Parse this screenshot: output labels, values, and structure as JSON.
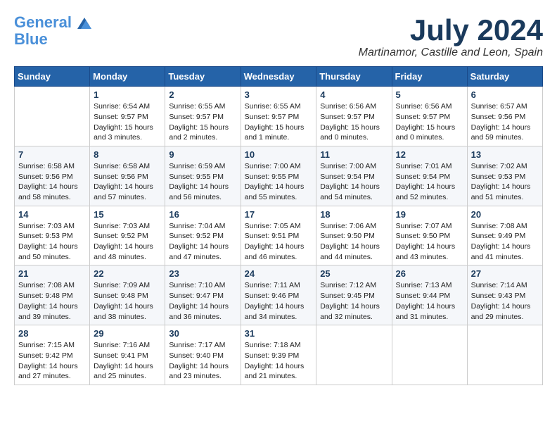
{
  "logo": {
    "line1": "General",
    "line2": "Blue"
  },
  "header": {
    "month": "July 2024",
    "location": "Martinamor, Castille and Leon, Spain"
  },
  "weekdays": [
    "Sunday",
    "Monday",
    "Tuesday",
    "Wednesday",
    "Thursday",
    "Friday",
    "Saturday"
  ],
  "weeks": [
    [
      {
        "day": "",
        "info": ""
      },
      {
        "day": "1",
        "info": "Sunrise: 6:54 AM\nSunset: 9:57 PM\nDaylight: 15 hours\nand 3 minutes."
      },
      {
        "day": "2",
        "info": "Sunrise: 6:55 AM\nSunset: 9:57 PM\nDaylight: 15 hours\nand 2 minutes."
      },
      {
        "day": "3",
        "info": "Sunrise: 6:55 AM\nSunset: 9:57 PM\nDaylight: 15 hours\nand 1 minute."
      },
      {
        "day": "4",
        "info": "Sunrise: 6:56 AM\nSunset: 9:57 PM\nDaylight: 15 hours\nand 0 minutes."
      },
      {
        "day": "5",
        "info": "Sunrise: 6:56 AM\nSunset: 9:57 PM\nDaylight: 15 hours\nand 0 minutes."
      },
      {
        "day": "6",
        "info": "Sunrise: 6:57 AM\nSunset: 9:56 PM\nDaylight: 14 hours\nand 59 minutes."
      }
    ],
    [
      {
        "day": "7",
        "info": "Sunrise: 6:58 AM\nSunset: 9:56 PM\nDaylight: 14 hours\nand 58 minutes."
      },
      {
        "day": "8",
        "info": "Sunrise: 6:58 AM\nSunset: 9:56 PM\nDaylight: 14 hours\nand 57 minutes."
      },
      {
        "day": "9",
        "info": "Sunrise: 6:59 AM\nSunset: 9:55 PM\nDaylight: 14 hours\nand 56 minutes."
      },
      {
        "day": "10",
        "info": "Sunrise: 7:00 AM\nSunset: 9:55 PM\nDaylight: 14 hours\nand 55 minutes."
      },
      {
        "day": "11",
        "info": "Sunrise: 7:00 AM\nSunset: 9:54 PM\nDaylight: 14 hours\nand 54 minutes."
      },
      {
        "day": "12",
        "info": "Sunrise: 7:01 AM\nSunset: 9:54 PM\nDaylight: 14 hours\nand 52 minutes."
      },
      {
        "day": "13",
        "info": "Sunrise: 7:02 AM\nSunset: 9:53 PM\nDaylight: 14 hours\nand 51 minutes."
      }
    ],
    [
      {
        "day": "14",
        "info": "Sunrise: 7:03 AM\nSunset: 9:53 PM\nDaylight: 14 hours\nand 50 minutes."
      },
      {
        "day": "15",
        "info": "Sunrise: 7:03 AM\nSunset: 9:52 PM\nDaylight: 14 hours\nand 48 minutes."
      },
      {
        "day": "16",
        "info": "Sunrise: 7:04 AM\nSunset: 9:52 PM\nDaylight: 14 hours\nand 47 minutes."
      },
      {
        "day": "17",
        "info": "Sunrise: 7:05 AM\nSunset: 9:51 PM\nDaylight: 14 hours\nand 46 minutes."
      },
      {
        "day": "18",
        "info": "Sunrise: 7:06 AM\nSunset: 9:50 PM\nDaylight: 14 hours\nand 44 minutes."
      },
      {
        "day": "19",
        "info": "Sunrise: 7:07 AM\nSunset: 9:50 PM\nDaylight: 14 hours\nand 43 minutes."
      },
      {
        "day": "20",
        "info": "Sunrise: 7:08 AM\nSunset: 9:49 PM\nDaylight: 14 hours\nand 41 minutes."
      }
    ],
    [
      {
        "day": "21",
        "info": "Sunrise: 7:08 AM\nSunset: 9:48 PM\nDaylight: 14 hours\nand 39 minutes."
      },
      {
        "day": "22",
        "info": "Sunrise: 7:09 AM\nSunset: 9:48 PM\nDaylight: 14 hours\nand 38 minutes."
      },
      {
        "day": "23",
        "info": "Sunrise: 7:10 AM\nSunset: 9:47 PM\nDaylight: 14 hours\nand 36 minutes."
      },
      {
        "day": "24",
        "info": "Sunrise: 7:11 AM\nSunset: 9:46 PM\nDaylight: 14 hours\nand 34 minutes."
      },
      {
        "day": "25",
        "info": "Sunrise: 7:12 AM\nSunset: 9:45 PM\nDaylight: 14 hours\nand 32 minutes."
      },
      {
        "day": "26",
        "info": "Sunrise: 7:13 AM\nSunset: 9:44 PM\nDaylight: 14 hours\nand 31 minutes."
      },
      {
        "day": "27",
        "info": "Sunrise: 7:14 AM\nSunset: 9:43 PM\nDaylight: 14 hours\nand 29 minutes."
      }
    ],
    [
      {
        "day": "28",
        "info": "Sunrise: 7:15 AM\nSunset: 9:42 PM\nDaylight: 14 hours\nand 27 minutes."
      },
      {
        "day": "29",
        "info": "Sunrise: 7:16 AM\nSunset: 9:41 PM\nDaylight: 14 hours\nand 25 minutes."
      },
      {
        "day": "30",
        "info": "Sunrise: 7:17 AM\nSunset: 9:40 PM\nDaylight: 14 hours\nand 23 minutes."
      },
      {
        "day": "31",
        "info": "Sunrise: 7:18 AM\nSunset: 9:39 PM\nDaylight: 14 hours\nand 21 minutes."
      },
      {
        "day": "",
        "info": ""
      },
      {
        "day": "",
        "info": ""
      },
      {
        "day": "",
        "info": ""
      }
    ]
  ]
}
